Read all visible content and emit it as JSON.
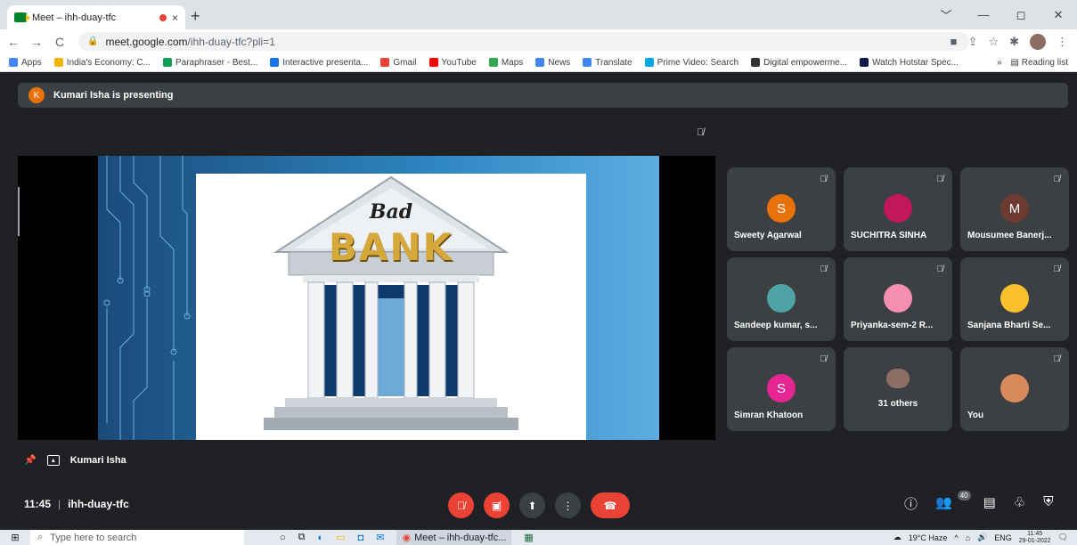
{
  "browser": {
    "tab_title": "Meet – ihh-duay-tfc",
    "tab_close": "×",
    "new_tab": "+",
    "url_host": "meet.google.com",
    "url_path": "/ihh-duay-tfc?pli=1",
    "window_controls": [
      "﹀",
      "—",
      "◻",
      "✕"
    ]
  },
  "bookmarks": {
    "items": [
      {
        "label": "Apps",
        "color": "#4285f4"
      },
      {
        "label": "India's Economy: C...",
        "color": "#f4b400"
      },
      {
        "label": "Paraphraser - Best...",
        "color": "#0f9d58"
      },
      {
        "label": "Interactive presenta...",
        "color": "#1a73e8"
      },
      {
        "label": "Gmail",
        "color": "#ea4335"
      },
      {
        "label": "YouTube",
        "color": "#ff0000"
      },
      {
        "label": "Maps",
        "color": "#34a853"
      },
      {
        "label": "News",
        "color": "#4285f4"
      },
      {
        "label": "Translate",
        "color": "#4285f4"
      },
      {
        "label": "Prime Video: Search",
        "color": "#00a8e1"
      },
      {
        "label": "Digital empowerme...",
        "color": "#333333"
      },
      {
        "label": "Watch Hotstar Spec...",
        "color": "#0c1a4d"
      }
    ],
    "more": "»",
    "reading_list": "Reading list"
  },
  "meet": {
    "presenting_initial": "K",
    "presenting_text": "Kumari Isha is presenting",
    "slide": {
      "bad": "Bad",
      "bank": "BANK"
    },
    "participants": [
      {
        "name": "Sweety Agarwal",
        "initial": "S",
        "color": "#e8710a",
        "type": "letter"
      },
      {
        "name": "SUCHITRA SINHA",
        "initial": "",
        "color": "#c2185b",
        "type": "photo"
      },
      {
        "name": "Mousumee Banerj...",
        "initial": "M",
        "color": "#6d3b31",
        "type": "letter"
      },
      {
        "name": "Sandeep kumar, s...",
        "initial": "",
        "color": "#4fa3a5",
        "type": "photo"
      },
      {
        "name": "Priyanka-sem-2 R...",
        "initial": "",
        "color": "#f48fb1",
        "type": "photo"
      },
      {
        "name": "Sanjana Bharti Se...",
        "initial": "",
        "color": "#fbc02d",
        "type": "photo"
      },
      {
        "name": "Simran Khatoon",
        "initial": "S",
        "color": "#e52592",
        "type": "letter"
      },
      {
        "name": "",
        "initial": "",
        "color": "#5f6368",
        "type": "others"
      },
      {
        "name": "You",
        "initial": "",
        "color": "#d88a5c",
        "type": "photo"
      }
    ],
    "others_label": "31 others",
    "pin_name": "Kumari Isha",
    "time": "11:45",
    "meeting_code": "ihh-duay-tfc",
    "people_count": "40"
  },
  "taskbar": {
    "search_placeholder": "Type here to search",
    "chrome_label": "Meet – ihh-duay-tfc...",
    "weather": "19°C Haze",
    "lang": "ENG",
    "clock_time": "11:45",
    "clock_date": "29-01-2022"
  }
}
